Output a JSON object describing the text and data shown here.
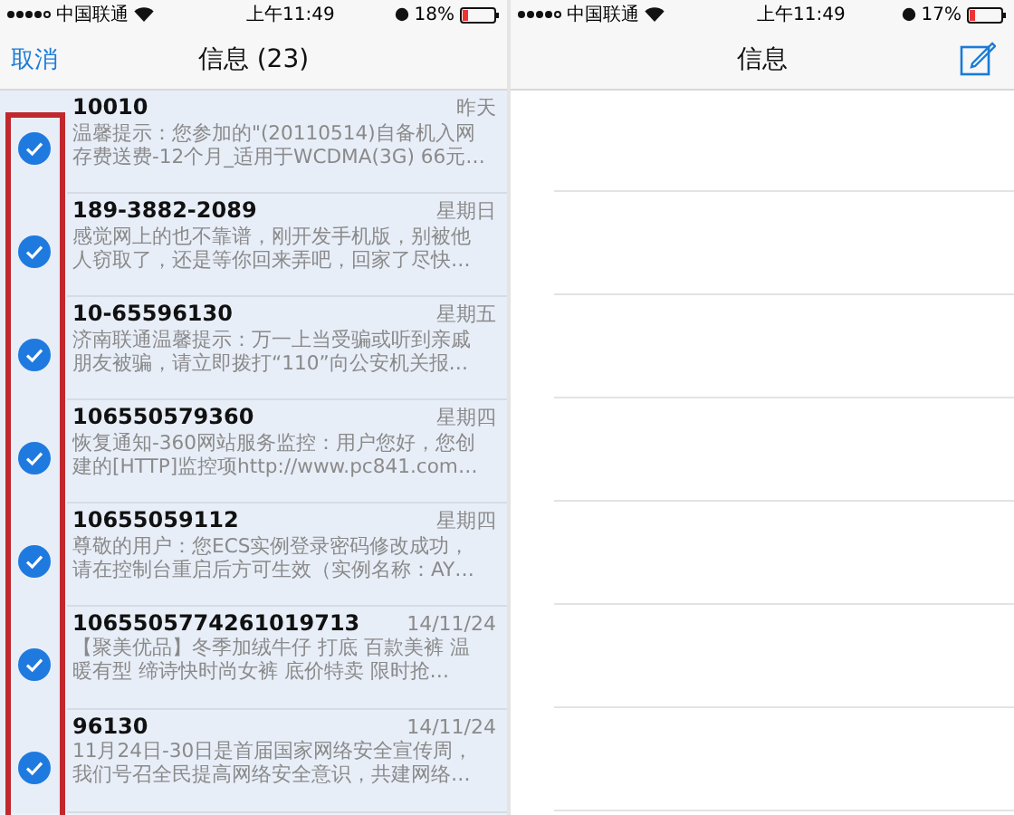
{
  "left_phone": {
    "status_bar": {
      "carrier": "中国联通",
      "time": "上午11:49",
      "battery": "18%"
    },
    "nav": {
      "cancel": "取消",
      "title": "信息 (23)"
    },
    "messages": [
      {
        "sender": "10010",
        "date": "昨天",
        "preview": "温馨提示：您参加的\"(20110514)自备机入网存费送费-12个月_适用于WCDMA(3G) 66元…",
        "selected": true
      },
      {
        "sender": "189-3882-2089",
        "date": "星期日",
        "preview": "感觉网上的也不靠谱，刚开发手机版，别被他人窃取了，还是等你回来弄吧，回家了尽快…",
        "selected": true
      },
      {
        "sender": "10-65596130",
        "date": "星期五",
        "preview": "济南联通温馨提示：万一上当受骗或听到亲戚朋友被骗，请立即拨打“110”向公安机关报…",
        "selected": true
      },
      {
        "sender": "106550579360",
        "date": "星期四",
        "preview": "恢复通知-360网站服务监控：用户您好，您创建的[HTTP]监控项http://www.pc841.com…",
        "selected": true
      },
      {
        "sender": "10655059112",
        "date": "星期四",
        "preview": "尊敬的用户：您ECS实例登录密码修改成功，请在控制台重启后方可生效（实例名称：AY…",
        "selected": true
      },
      {
        "sender": "1065505774261019713",
        "date": "14/11/24",
        "preview": "【聚美优品】冬季加绒牛仔 打底 百款美裤 温暖有型 缔诗快时尚女裤  底价特卖 限时抢…",
        "selected": true
      },
      {
        "sender": "96130",
        "date": "14/11/24",
        "preview": "11月24日-30日是首届国家网络安全宣传周，我们号召全民提高网络安全意识，共建网络…",
        "selected": true
      }
    ]
  },
  "right_phone": {
    "status_bar": {
      "carrier": "中国联通",
      "time": "上午11:49",
      "battery": "17%"
    },
    "nav": {
      "title": "信息"
    }
  }
}
